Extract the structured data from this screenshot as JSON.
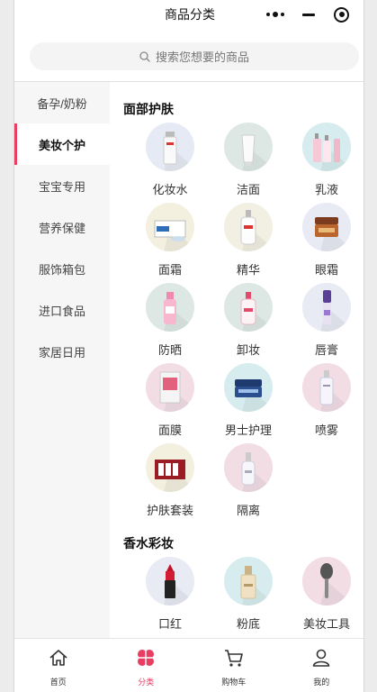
{
  "navbar": {
    "title": "商品分类"
  },
  "search": {
    "placeholder": "搜索您想要的商品"
  },
  "sidebar": {
    "items": [
      {
        "label": "备孕/奶粉"
      },
      {
        "label": "美妆个护"
      },
      {
        "label": "宝宝专用"
      },
      {
        "label": "营养保健"
      },
      {
        "label": "服饰箱包"
      },
      {
        "label": "进口食品"
      },
      {
        "label": "家居日用"
      }
    ],
    "active_index": 1
  },
  "sections": [
    {
      "title": "面部护肤",
      "items": [
        {
          "label": "化妆水",
          "icon": "toner-bottle-icon",
          "color": "#e6eaf4"
        },
        {
          "label": "洁面",
          "icon": "cleanser-tube-icon",
          "color": "#dde8e4"
        },
        {
          "label": "乳液",
          "icon": "lotion-bottles-icon",
          "color": "#d6ecee"
        },
        {
          "label": "面霜",
          "icon": "cream-box-icon",
          "color": "#f3f0e0"
        },
        {
          "label": "精华",
          "icon": "serum-bottle-icon",
          "color": "#f2f0e2"
        },
        {
          "label": "眼霜",
          "icon": "eye-cream-jar-icon",
          "color": "#e8eaf4"
        },
        {
          "label": "防晒",
          "icon": "sunscreen-bottle-icon",
          "color": "#dde8e4"
        },
        {
          "label": "卸妆",
          "icon": "makeup-remover-icon",
          "color": "#dde8e4"
        },
        {
          "label": "唇膏",
          "icon": "lip-balm-icon",
          "color": "#e8eaf4"
        },
        {
          "label": "面膜",
          "icon": "face-mask-icon",
          "color": "#f2dde5"
        },
        {
          "label": "男士护理",
          "icon": "men-care-jar-icon",
          "color": "#d6ecee"
        },
        {
          "label": "喷雾",
          "icon": "spray-bottle-icon",
          "color": "#f2dde5"
        },
        {
          "label": "护肤套装",
          "icon": "skincare-set-icon",
          "color": "#f3f0e0"
        },
        {
          "label": "隔离",
          "icon": "primer-bottle-icon",
          "color": "#f2dde5"
        }
      ]
    },
    {
      "title": "香水彩妆",
      "items": [
        {
          "label": "口红",
          "icon": "lipstick-icon",
          "color": "#e8eaf4"
        },
        {
          "label": "粉底",
          "icon": "foundation-bottle-icon",
          "color": "#d6ecee"
        },
        {
          "label": "美妆工具",
          "icon": "makeup-brush-icon",
          "color": "#f2dde5"
        }
      ]
    }
  ],
  "tabbar": {
    "items": [
      {
        "label": "首页",
        "icon": "home-icon"
      },
      {
        "label": "分类",
        "icon": "category-icon"
      },
      {
        "label": "购物车",
        "icon": "cart-icon"
      },
      {
        "label": "我的",
        "icon": "user-icon"
      }
    ],
    "active_index": 1,
    "accent": "#e83e62"
  }
}
